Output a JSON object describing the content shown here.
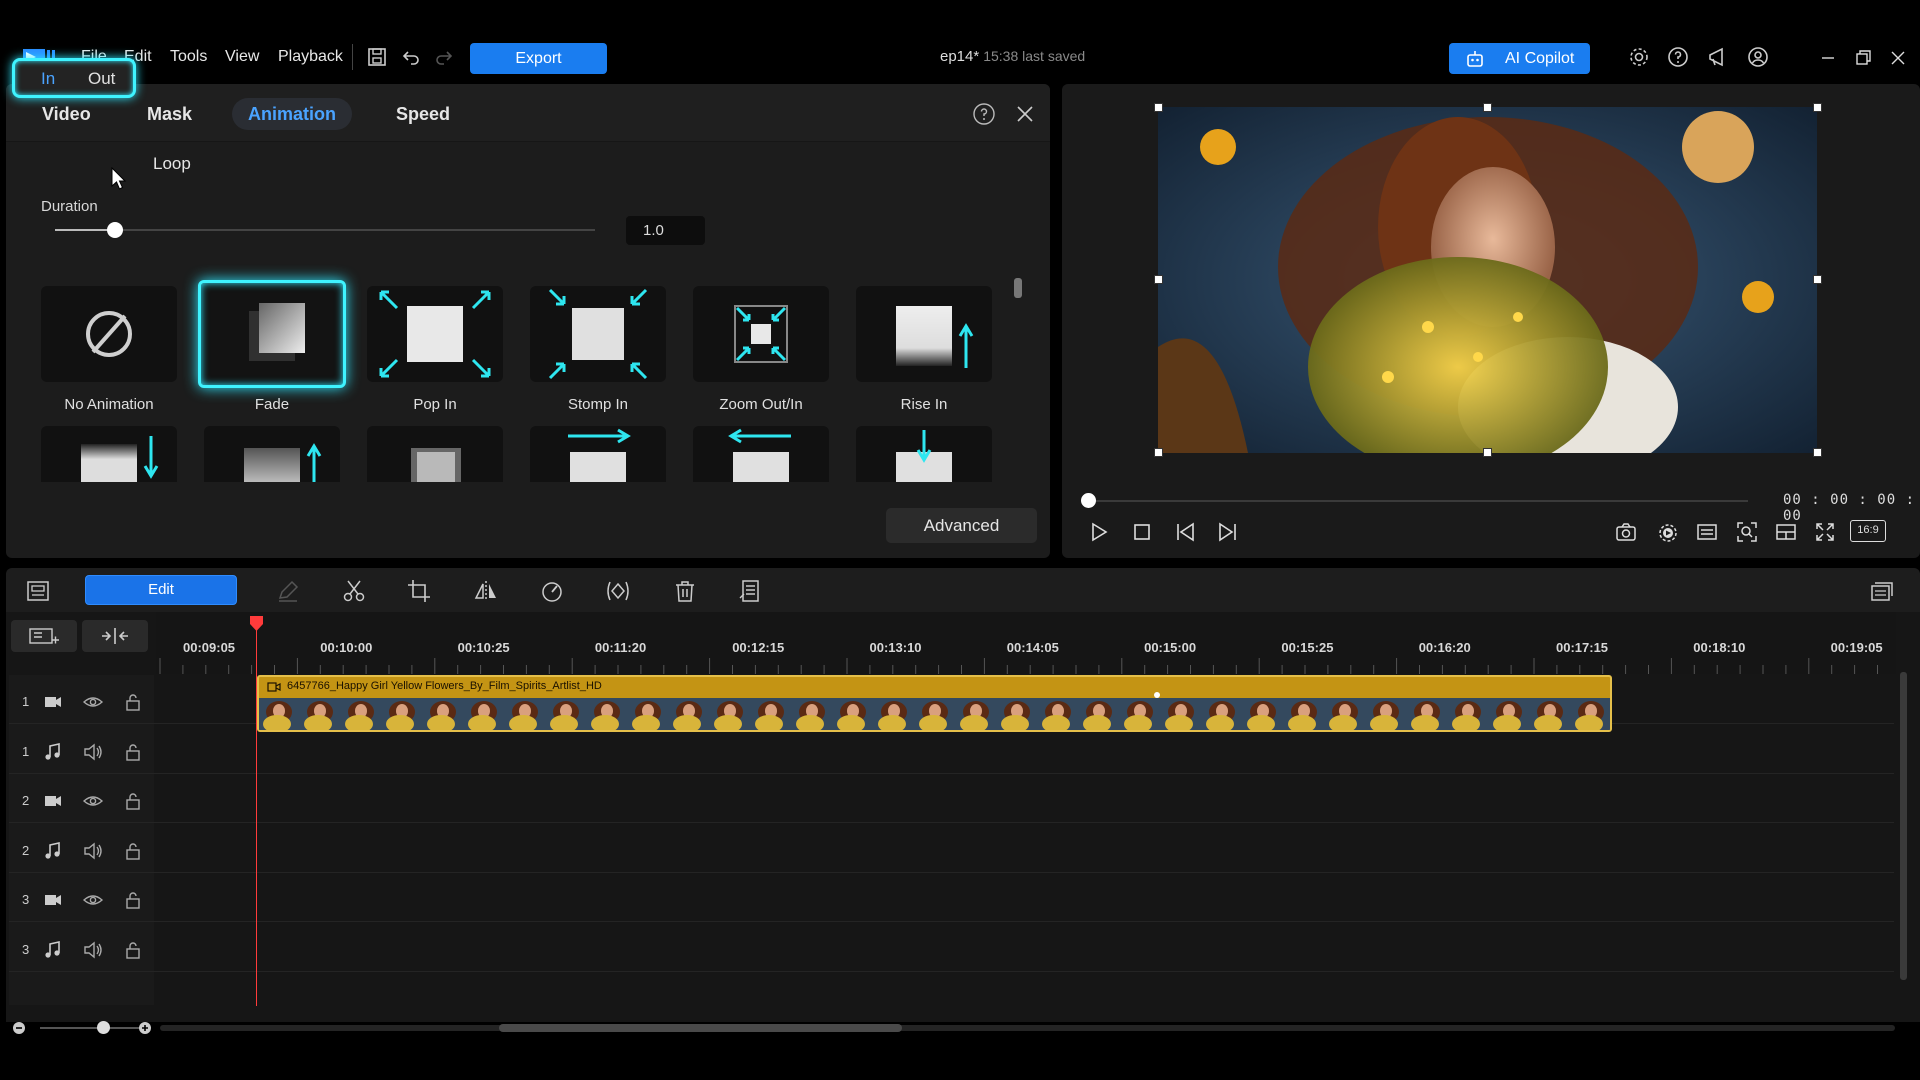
{
  "menu": {
    "items": [
      "File",
      "Edit",
      "Tools",
      "View",
      "Playback"
    ],
    "export_label": "Export",
    "project_name": "ep14*",
    "save_status": "15:38 last saved",
    "copilot_label": "AI Copilot"
  },
  "panel": {
    "tabs": [
      "Video",
      "Mask",
      "Animation",
      "Speed"
    ],
    "active_tab": "Animation",
    "subtabs": [
      "In",
      "Out",
      "Loop"
    ],
    "active_subtab": "In",
    "duration_label": "Duration",
    "duration_value": "1.0",
    "presets": [
      {
        "label": "No Animation"
      },
      {
        "label": "Fade",
        "selected": true
      },
      {
        "label": "Pop In"
      },
      {
        "label": "Stomp In"
      },
      {
        "label": "Zoom Out/In"
      },
      {
        "label": "Rise In"
      }
    ],
    "advanced_label": "Advanced"
  },
  "preview": {
    "timecode": "00 : 00 : 00 : 00",
    "aspect": "16:9"
  },
  "timeline": {
    "edit_label": "Edit",
    "ruler_ticks": [
      "00:09:05",
      "00:10:00",
      "00:10:25",
      "00:11:20",
      "00:12:15",
      "00:13:10",
      "00:14:05",
      "00:15:00",
      "00:15:25",
      "00:16:20",
      "00:17:15",
      "00:18:10",
      "00:19:05"
    ],
    "tracks": [
      {
        "num": "1",
        "type": "video"
      },
      {
        "num": "1",
        "type": "audio"
      },
      {
        "num": "2",
        "type": "video"
      },
      {
        "num": "2",
        "type": "audio"
      },
      {
        "num": "3",
        "type": "video"
      },
      {
        "num": "3",
        "type": "audio"
      }
    ],
    "clip_title": "6457766_Happy Girl Yellow Flowers_By_Film_Spirits_Artlist_HD"
  },
  "colors": {
    "accent": "#1a7df0",
    "highlight": "#3ff3ff",
    "clip": "#c49414",
    "playhead": "#ff3b3b"
  }
}
